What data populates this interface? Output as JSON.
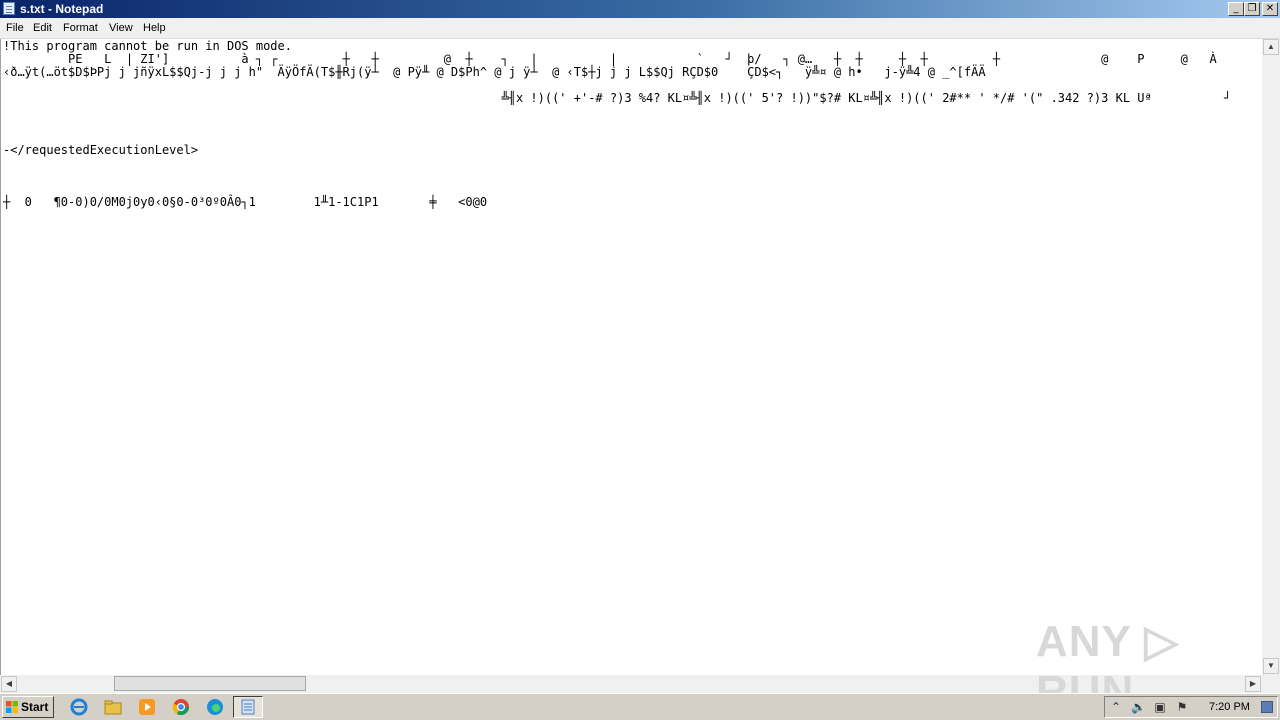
{
  "window": {
    "title": "s.txt - Notepad",
    "minimize_glyph": "_",
    "maximize_glyph": "❐",
    "close_glyph": "✕"
  },
  "menu": {
    "file": "File",
    "edit": "Edit",
    "format": "Format",
    "view": "View",
    "help": "Help"
  },
  "editor": {
    "lines": [
      "!This program cannot be run in DOS mode.",
      "         PE   L  | ZI']          à ┐ ┌         ┼   ┼         @  ┼    ┐   |          |           `   ┘  þ/   ┐ @…   ┼  ┼     ┼  ┼         ┼              @    P     @   À",
      "‹ð…ÿt(…öt$D$ÞPj j jñÿxL$$Qj-j j j h\"  ÄÿÖfÄ(T$╫Rj(ÿ┴  @ Pÿ╨ @ D$Ph^ @ j ÿ┴  @ ‹T$┼j j j L$$Qj RÇD$0    ÇD$<┐   ÿ╩¤ @ h•   j-ÿ╩4 @ _^[fÄÄ",
      "                                                                     ╩╢x !)((' +'-# ?)3 %4? KL¤╩╢x !)((' 5'? !))\"$?# KL¤╩╢x !)((' 2#** ' */# '(\" .342 ?)3 KL Uª          ┘",
      "",
      "",
      "",
      "-</requestedExecutionLevel>",
      "",
      "",
      "",
      "┼  0   ¶0-0)0/0M0j0y0‹0§0-0³0º0Â0┐1        1╨1-1C1P1       ╪   <0@0"
    ]
  },
  "watermark": "ANY ▷ RUN",
  "taskbar": {
    "start_label": "Start",
    "clock": "7:20 PM",
    "accent_color": "#0a246a"
  }
}
